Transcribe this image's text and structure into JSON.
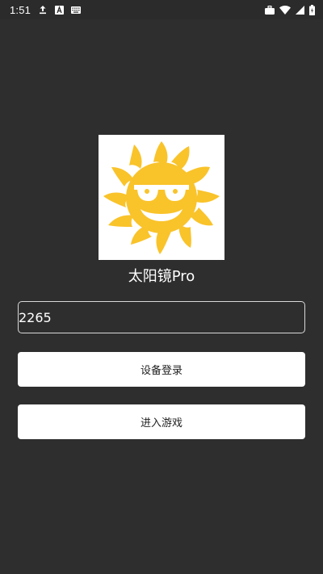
{
  "status_bar": {
    "time": "1:51",
    "left_icons": [
      "upload-arrow-icon",
      "a-badge-icon",
      "keyboard-icon"
    ],
    "right_icons": [
      "briefcase-icon",
      "wifi-icon",
      "signal-icon",
      "battery-icon"
    ]
  },
  "app": {
    "logo": "sun-with-sunglasses-logo",
    "name": "太阳镜Pro",
    "accent": "#f9c32a"
  },
  "form": {
    "code_value": "2265"
  },
  "buttons": {
    "device_login": "设备登录",
    "enter_game": "进入游戏"
  },
  "colors": {
    "background": "#2e2e2e",
    "button_bg": "#ffffff",
    "button_text": "#222222",
    "input_border": "#d9d9d9",
    "sun_yellow": "#f9c32a"
  }
}
